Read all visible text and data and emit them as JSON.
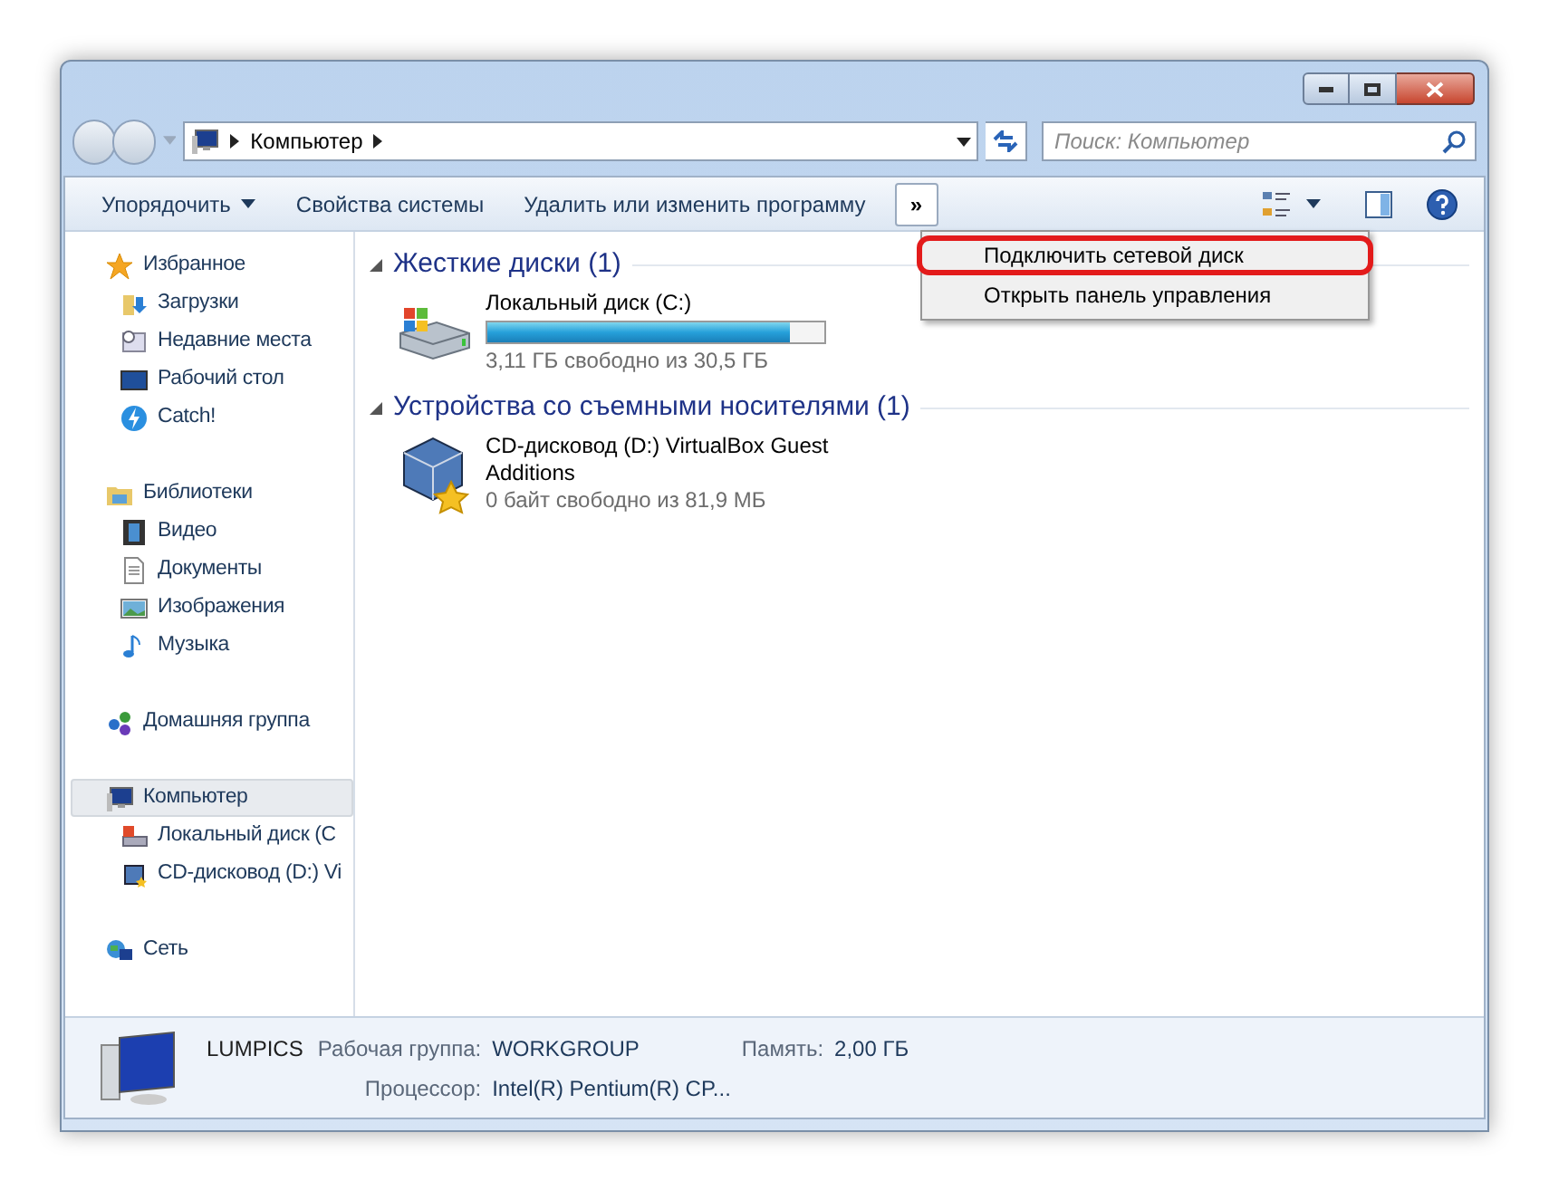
{
  "address_bar": {
    "path": [
      "Компьютер"
    ],
    "search_placeholder": "Поиск: Компьютер"
  },
  "toolbar": {
    "buttons": [
      "Упорядочить",
      "Свойства системы",
      "Удалить или изменить программу"
    ],
    "overflow": "»"
  },
  "context_menu": [
    {
      "label": "Подключить сетевой диск",
      "highlighted": true
    },
    {
      "label": "Открыть панель управления",
      "highlighted": false
    }
  ],
  "sidebar": [
    {
      "label": "Избранное",
      "selected": false,
      "children": [
        {
          "label": "Загрузки",
          "selected": false
        },
        {
          "label": "Недавние места",
          "selected": false
        },
        {
          "label": "Рабочий стол",
          "selected": false
        },
        {
          "label": "Catch!",
          "selected": false
        }
      ]
    },
    {
      "label": "Библиотеки",
      "selected": false,
      "children": [
        {
          "label": "Видео",
          "selected": false
        },
        {
          "label": "Документы",
          "selected": false
        },
        {
          "label": "Изображения",
          "selected": false
        },
        {
          "label": "Музыка",
          "selected": false
        }
      ]
    },
    {
      "label": "Домашняя группа",
      "selected": false
    },
    {
      "label": "Компьютер",
      "selected": true,
      "children": [
        {
          "label": "Локальный диск (C",
          "selected": false
        },
        {
          "label": "CD-дисковод (D:) Vi",
          "selected": false
        }
      ]
    },
    {
      "label": "Сеть",
      "selected": false
    }
  ],
  "groups": [
    {
      "title": "Жесткие диски (1)",
      "items": [
        {
          "kind": "disk",
          "name": "Локальный диск (C:)",
          "level": 0.898,
          "info": "3,11 ГБ свободно из 30,5 ГБ"
        }
      ]
    },
    {
      "title": "Устройства со съемными носителями (1)",
      "items": [
        {
          "kind": "cd",
          "name": "CD-дисковод (D:) VirtualBox Guest Additions",
          "info": "0 байт свободно из 81,9 МБ"
        }
      ]
    }
  ],
  "status": {
    "computer": "LUMPICS",
    "workgroup_label": "Рабочая группа:",
    "workgroup": "WORKGROUP",
    "memory_label": "Память:",
    "memory": "2,00 ГБ",
    "cpu_label": "Процессор:",
    "cpu": "Intel(R) Pentium(R) CP..."
  }
}
